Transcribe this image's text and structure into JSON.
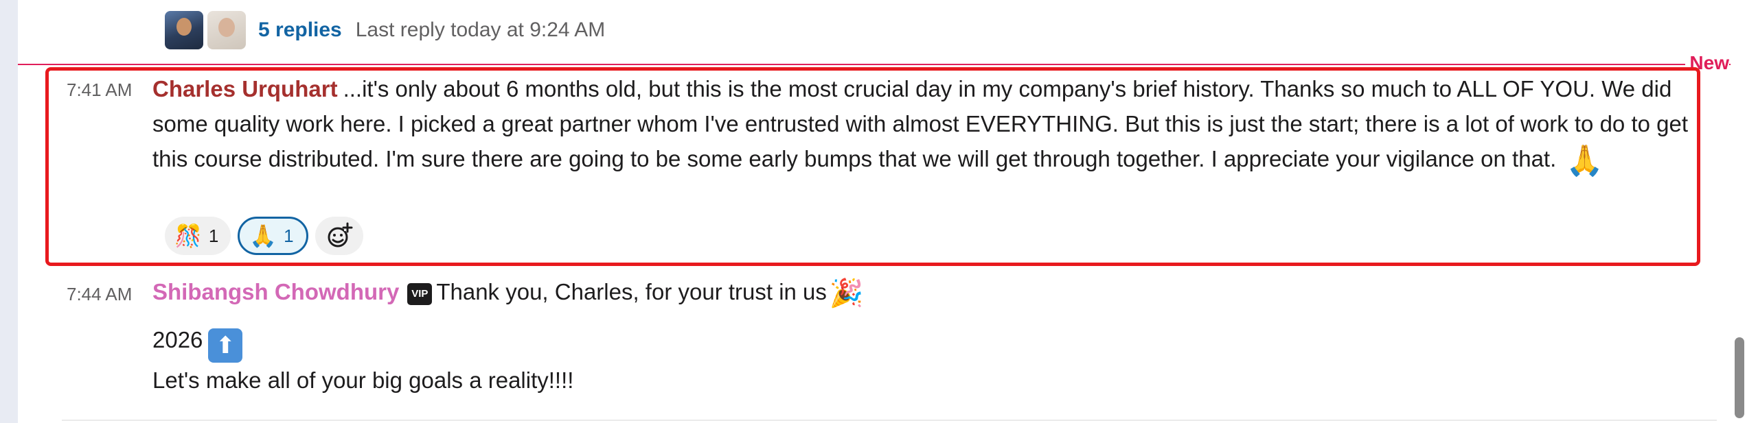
{
  "thread": {
    "replies": "5 replies",
    "last_reply": "Last reply today at 9:24 AM"
  },
  "divider": {
    "label": "New"
  },
  "message1": {
    "time": "7:41 AM",
    "author": "Charles Urquhart",
    "text": "...it's only about 6 months old, but this is the most crucial day in my company's brief history.  Thanks so much to ALL OF YOU. We did some quality work here.  I picked a great partner whom I've entrusted with almost EVERYTHING.  But this is just the start; there is a lot of work to do to get this course distributed.  I'm sure there are going to be some early bumps that we will get through together.  I appreciate your vigilance on that.",
    "trailing_emoji": "🙏",
    "reactions": [
      {
        "emoji": "🎊",
        "count": "1",
        "active": false
      },
      {
        "emoji": "🙏",
        "count": "1",
        "active": true
      }
    ],
    "add_reaction_icon": "add-reaction-icon"
  },
  "message2": {
    "time": "7:44 AM",
    "author": "Shibangsh Chowdhury",
    "badge": "VIP",
    "text": "Thank you, Charles, for your trust in us",
    "emoji": "🎉",
    "line2": "2026",
    "line2_emoji": "⬆",
    "line3": "Let's make all of your big goals a reality!!!!"
  },
  "colors": {
    "link": "#1264a3",
    "new_divider": "#e01e5a",
    "highlight": "#e8191e",
    "author1": "#a5302e",
    "author2": "#d368b6"
  }
}
